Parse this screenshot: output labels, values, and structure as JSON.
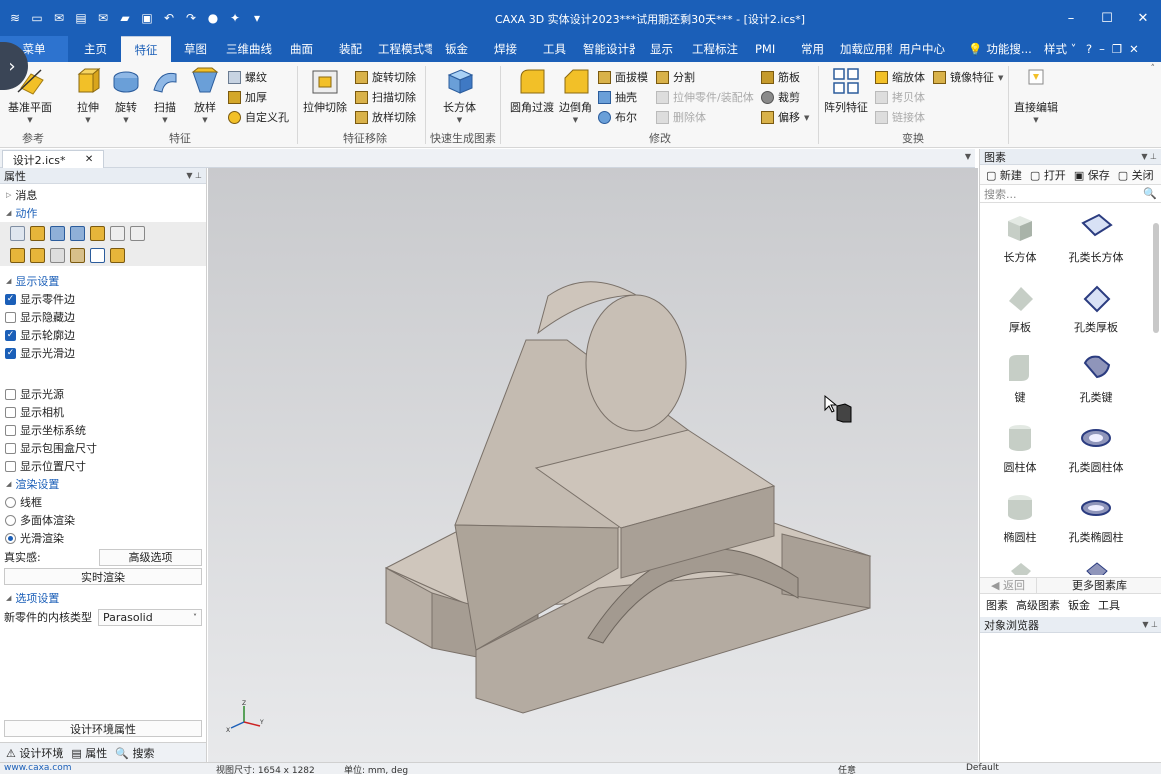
{
  "window": {
    "title": "CAXA 3D 实体设计2023***试用期还剩30天*** - [设计2.ics*]"
  },
  "tabs": [
    "菜单",
    "主页",
    "特征",
    "草图",
    "三维曲线",
    "曲面",
    "装配",
    "工程模式零",
    "钣金",
    "焊接",
    "工具",
    "智能设计器",
    "显示",
    "工程标注",
    "PMI",
    "常用",
    "加载应用程序",
    "用户中心"
  ],
  "tabs_right": {
    "search": "功能搜...",
    "style": "样式"
  },
  "ribbon": {
    "groups": [
      "参考",
      "特征",
      "特征移除",
      "快速生成图素",
      "修改",
      "变换"
    ],
    "large": [
      "基准平面",
      "拉伸",
      "旋转",
      "扫描",
      "放样",
      "拉伸切除",
      "长方体",
      "圆角过渡",
      "边倒角",
      "阵列特征",
      "直接编辑"
    ],
    "small_feature": [
      "螺纹",
      "加厚",
      "自定义孔"
    ],
    "small_remove": [
      "旋转切除",
      "扫描切除",
      "放样切除"
    ],
    "small_mod1": [
      "面拔模",
      "抽壳",
      "布尔"
    ],
    "small_mod2": [
      "分割",
      "拉伸零件/装配体",
      "删除体"
    ],
    "small_mod3": [
      "筋板",
      "裁剪",
      "偏移"
    ],
    "small_trans": [
      "缩放体",
      "拷贝体",
      "链接体"
    ],
    "mirror": "镜像特征"
  },
  "doc_tab": {
    "label": "设计2.ics*"
  },
  "left_panel": {
    "title": "属性",
    "message": "消息",
    "action": "动作",
    "display_title": "显示设置",
    "display_items": [
      {
        "label": "显示零件边",
        "checked": true
      },
      {
        "label": "显示隐藏边",
        "checked": false
      },
      {
        "label": "显示轮廓边",
        "checked": true
      },
      {
        "label": "显示光滑边",
        "checked": true
      }
    ],
    "display_items2": [
      {
        "label": "显示光源",
        "checked": false
      },
      {
        "label": "显示相机",
        "checked": false
      },
      {
        "label": "显示坐标系统",
        "checked": false
      },
      {
        "label": "显示包围盒尺寸",
        "checked": false
      },
      {
        "label": "显示位置尺寸",
        "checked": false
      }
    ],
    "render_title": "渲染设置",
    "render_options": [
      {
        "label": "线框",
        "selected": false
      },
      {
        "label": "多面体渲染",
        "selected": false
      },
      {
        "label": "光滑渲染",
        "selected": true
      }
    ],
    "realism_label": "真实感:",
    "advanced_button": "高级选项",
    "realtime_button": "实时渲染",
    "options_title": "选项设置",
    "kernel_label": "新零件的内核类型",
    "kernel_value": "Parasolid",
    "env_button": "设计环境属性",
    "bottom_tabs": [
      "设计环境",
      "属性",
      "搜索"
    ]
  },
  "right_panel": {
    "title": "图素",
    "toolbar": [
      "新建",
      "打开",
      "保存",
      "关闭"
    ],
    "search_placeholder": "搜索...",
    "items": [
      "长方体",
      "孔类长方体",
      "厚板",
      "孔类厚板",
      "键",
      "孔类键",
      "圆柱体",
      "孔类圆柱体",
      "椭圆柱",
      "孔类椭圆柱"
    ],
    "back": "返回",
    "more": "更多图素库",
    "tabs": [
      "图素",
      "高级图素",
      "钣金",
      "工具"
    ],
    "browser_title": "对象浏览器"
  },
  "statusbar": {
    "url": "www.caxa.com",
    "view_size": "视图尺寸: 1654 x 1282",
    "unit": "单位: mm, deg",
    "filter": "任意",
    "config": "Default"
  },
  "colors": {
    "title_bar": "#1b5fb8",
    "accent": "#1b5fb8",
    "model": "#b4aba1"
  }
}
